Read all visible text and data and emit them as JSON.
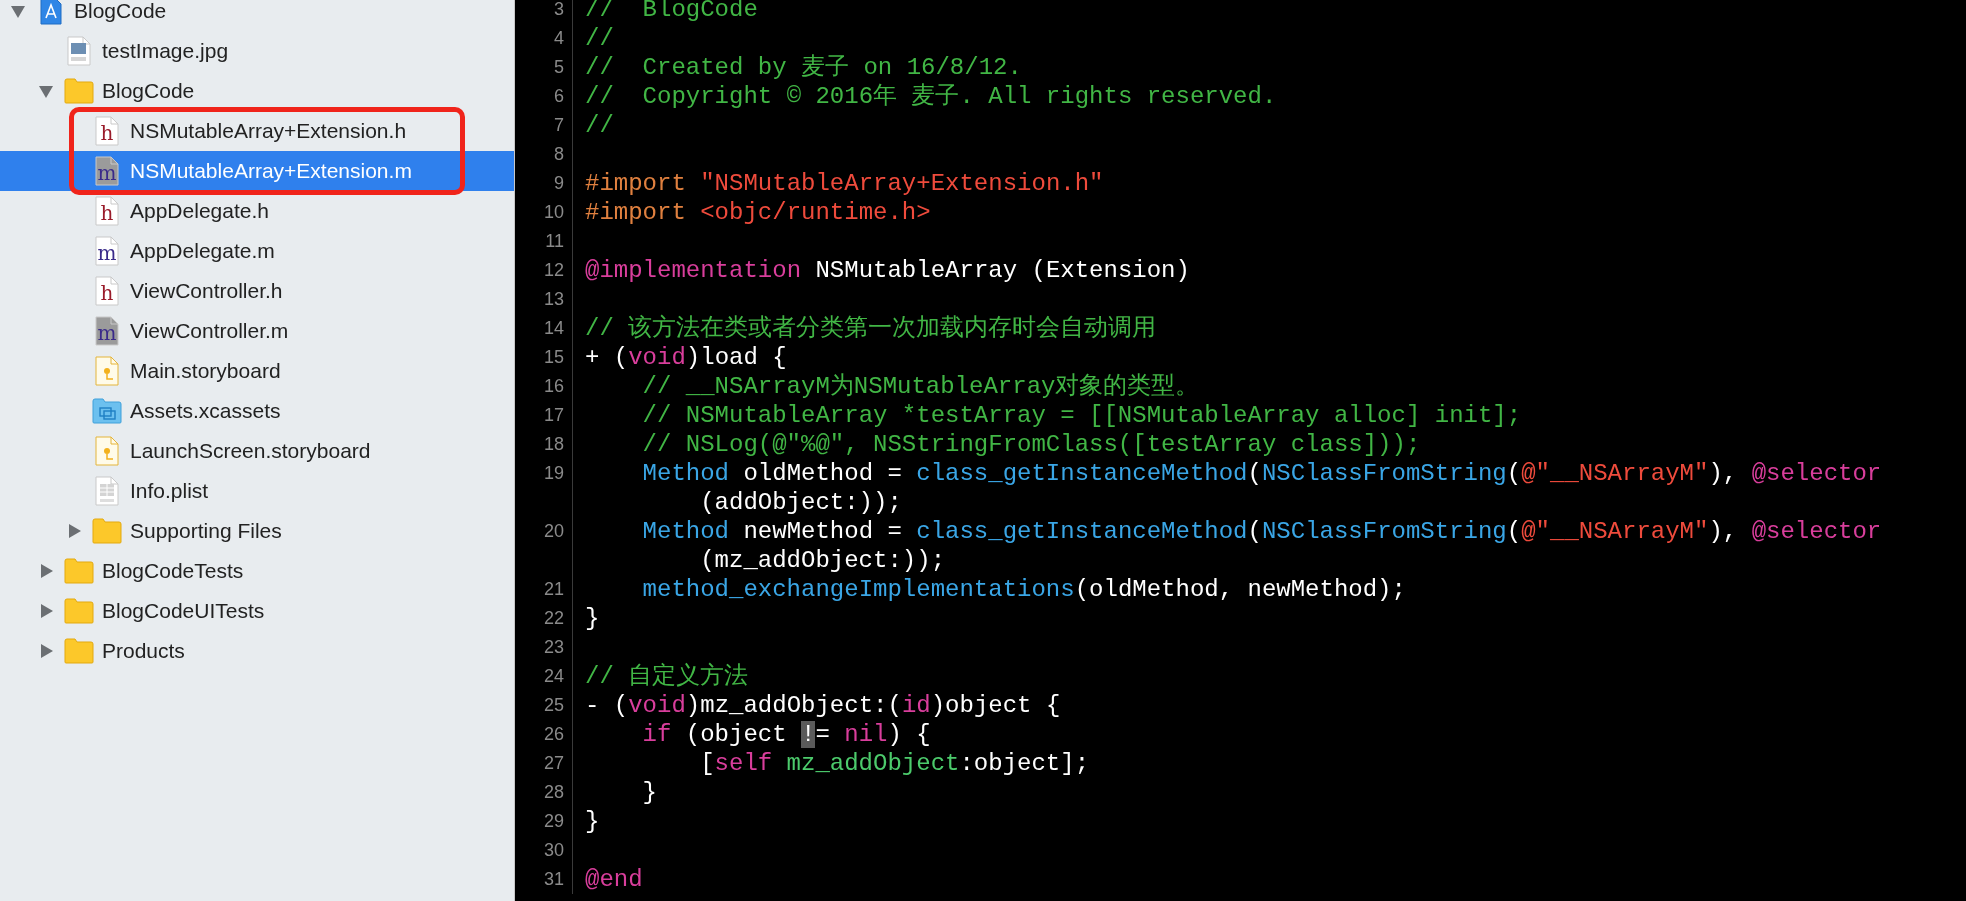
{
  "navigator": {
    "items": [
      {
        "label": "BlogCode",
        "kind": "project",
        "expanded": true,
        "selected": false,
        "annotated": false,
        "children": [
          {
            "label": "testImage.jpg",
            "kind": "image",
            "selected": false,
            "annotated": false
          },
          {
            "label": "BlogCode",
            "kind": "folder",
            "expanded": true,
            "selected": false,
            "annotated": false,
            "children": [
              {
                "label": "NSMutableArray+Extension.h",
                "kind": "doc",
                "badge": "h",
                "selected": false,
                "annotated": true
              },
              {
                "label": "NSMutableArray+Extension.m",
                "kind": "doc-dark",
                "badge": "m",
                "selected": true,
                "annotated": true
              },
              {
                "label": "AppDelegate.h",
                "kind": "doc",
                "badge": "h",
                "selected": false,
                "annotated": false
              },
              {
                "label": "AppDelegate.m",
                "kind": "doc",
                "badge": "m",
                "selected": false,
                "annotated": false
              },
              {
                "label": "ViewController.h",
                "kind": "doc",
                "badge": "h",
                "selected": false,
                "annotated": false
              },
              {
                "label": "ViewController.m",
                "kind": "doc-dark",
                "badge": "m",
                "selected": false,
                "annotated": false
              },
              {
                "label": "Main.storyboard",
                "kind": "storyboard",
                "selected": false,
                "annotated": false
              },
              {
                "label": "Assets.xcassets",
                "kind": "assets",
                "selected": false,
                "annotated": false
              },
              {
                "label": "LaunchScreen.storyboard",
                "kind": "storyboard",
                "selected": false,
                "annotated": false
              },
              {
                "label": "Info.plist",
                "kind": "plist",
                "selected": false,
                "annotated": false
              },
              {
                "label": "Supporting Files",
                "kind": "folder",
                "expanded": false,
                "selected": false,
                "annotated": false
              }
            ]
          },
          {
            "label": "BlogCodeTests",
            "kind": "folder",
            "expanded": false,
            "selected": false,
            "annotated": false
          },
          {
            "label": "BlogCodeUITests",
            "kind": "folder",
            "expanded": false,
            "selected": false,
            "annotated": false
          },
          {
            "label": "Products",
            "kind": "folder",
            "expanded": false,
            "selected": false,
            "annotated": false
          }
        ]
      }
    ]
  },
  "editor": {
    "lines": [
      {
        "number": "3",
        "kind": "top",
        "segments": [
          {
            "kind": "comment",
            "text": "//  BlogCode"
          }
        ]
      },
      {
        "number": "4",
        "kind": "top",
        "segments": [
          {
            "kind": "comment",
            "text": "//"
          }
        ]
      },
      {
        "number": "5",
        "kind": "top",
        "segments": [
          {
            "kind": "comment",
            "text": "//  Created by 麦子 on 16/8/12."
          }
        ]
      },
      {
        "number": "6",
        "kind": "top",
        "segments": [
          {
            "kind": "comment",
            "text": "//  Copyright © 2016年 麦子. All rights reserved."
          }
        ]
      },
      {
        "number": "7",
        "kind": "top",
        "segments": [
          {
            "kind": "comment",
            "text": "//"
          }
        ]
      },
      {
        "number": "8",
        "kind": "top"
      },
      {
        "number": "9",
        "kind": "top",
        "segments": [
          {
            "kind": "preprocessor",
            "text": "#import "
          },
          {
            "kind": "string",
            "text": "\"NSMutableArray+Extension.h\""
          }
        ]
      },
      {
        "number": "10",
        "kind": "top",
        "segments": [
          {
            "kind": "preprocessor",
            "text": "#import "
          },
          {
            "kind": "string",
            "text": "<objc/runtime.h>"
          }
        ]
      },
      {
        "number": "11",
        "kind": "top"
      },
      {
        "number": "12",
        "kind": "top",
        "segments": [
          {
            "kind": "keyword",
            "text": "@implementation"
          },
          {
            "kind": "plain",
            "text": " NSMutableArray (Extension)"
          }
        ]
      },
      {
        "number": "13",
        "kind": "top"
      },
      {
        "number": "14",
        "kind": "top",
        "segments": [
          {
            "kind": "comment",
            "text": "// 该方法在类或者分类第一次加载内存时会自动调用"
          }
        ]
      },
      {
        "number": "15",
        "kind": "top",
        "segments": [
          {
            "kind": "plain",
            "text": "+ ("
          },
          {
            "kind": "keyword",
            "text": "void"
          },
          {
            "kind": "plain",
            "text": ")load {"
          }
        ]
      },
      {
        "number": "16",
        "kind": "indented",
        "segments": [
          {
            "kind": "comment",
            "text": "// __NSArrayM为NSMutableArray对象的类型。"
          }
        ]
      },
      {
        "number": "17",
        "kind": "indented",
        "segments": [
          {
            "kind": "comment",
            "text": "// NSMutableArray *testArray = [[NSMutableArray alloc] init];"
          }
        ]
      },
      {
        "number": "18",
        "kind": "indented",
        "segments": [
          {
            "kind": "comment",
            "text": "// NSLog(@\"%@\", NSStringFromClass([testArray class]));"
          }
        ]
      },
      {
        "number": "19",
        "kind": "indented",
        "segments": [
          {
            "kind": "type",
            "text": "Method"
          },
          {
            "kind": "plain",
            "text": " oldMethod = "
          },
          {
            "kind": "type",
            "text": "class_getInstanceMethod"
          },
          {
            "kind": "plain",
            "text": "("
          },
          {
            "kind": "type",
            "text": "NSClassFromString"
          },
          {
            "kind": "plain",
            "text": "("
          },
          {
            "kind": "string",
            "text": "@\"__NSArrayM\""
          },
          {
            "kind": "plain",
            "text": "), "
          },
          {
            "kind": "keyword",
            "text": "@selector"
          }
        ],
        "wrap": [
          {
            "kind": "plain",
            "text": "(addObject:));"
          }
        ]
      },
      {
        "number": "20",
        "kind": "indented",
        "segments": [
          {
            "kind": "type",
            "text": "Method"
          },
          {
            "kind": "plain",
            "text": " newMethod = "
          },
          {
            "kind": "type",
            "text": "class_getInstanceMethod"
          },
          {
            "kind": "plain",
            "text": "("
          },
          {
            "kind": "type",
            "text": "NSClassFromString"
          },
          {
            "kind": "plain",
            "text": "("
          },
          {
            "kind": "string",
            "text": "@\"__NSArrayM\""
          },
          {
            "kind": "plain",
            "text": "), "
          },
          {
            "kind": "keyword",
            "text": "@selector"
          }
        ],
        "wrap": [
          {
            "kind": "plain",
            "text": "(mz_addObject:));"
          }
        ]
      },
      {
        "number": "21",
        "kind": "indented",
        "segments": [
          {
            "kind": "type",
            "text": "method_exchangeImplementations"
          },
          {
            "kind": "plain",
            "text": "(oldMethod, newMethod);"
          }
        ]
      },
      {
        "number": "22",
        "kind": "top",
        "segments": [
          {
            "kind": "plain",
            "text": "}"
          }
        ]
      },
      {
        "number": "23",
        "kind": "top"
      },
      {
        "number": "24",
        "kind": "top",
        "segments": [
          {
            "kind": "comment",
            "text": "// 自定义方法"
          }
        ]
      },
      {
        "number": "25",
        "kind": "top",
        "segments": [
          {
            "kind": "plain",
            "text": "- ("
          },
          {
            "kind": "keyword",
            "text": "void"
          },
          {
            "kind": "plain",
            "text": ")mz_addObject:("
          },
          {
            "kind": "keyword",
            "text": "id"
          },
          {
            "kind": "plain",
            "text": ")object {"
          }
        ]
      },
      {
        "number": "26",
        "kind": "indented",
        "segments": [
          {
            "kind": "keyword",
            "text": "if"
          },
          {
            "kind": "plain",
            "text": " (object "
          },
          {
            "kind": "cursor",
            "text": "!"
          },
          {
            "kind": "plain",
            "text": "= "
          },
          {
            "kind": "keyword",
            "text": "nil"
          },
          {
            "kind": "plain",
            "text": ") {"
          }
        ]
      },
      {
        "number": "27",
        "kind": "double-indented",
        "segments": [
          {
            "kind": "plain",
            "text": "["
          },
          {
            "kind": "keyword",
            "text": "self "
          },
          {
            "kind": "project",
            "text": "mz_addObject"
          },
          {
            "kind": "plain",
            "text": ":object];"
          }
        ]
      },
      {
        "number": "28",
        "kind": "indented",
        "segments": [
          {
            "kind": "plain",
            "text": "}"
          }
        ]
      },
      {
        "number": "29",
        "kind": "top",
        "segments": [
          {
            "kind": "plain",
            "text": "}"
          }
        ]
      },
      {
        "number": "30",
        "kind": "top"
      },
      {
        "number": "31",
        "kind": "top",
        "segments": [
          {
            "kind": "keyword",
            "text": "@end"
          }
        ]
      }
    ]
  }
}
